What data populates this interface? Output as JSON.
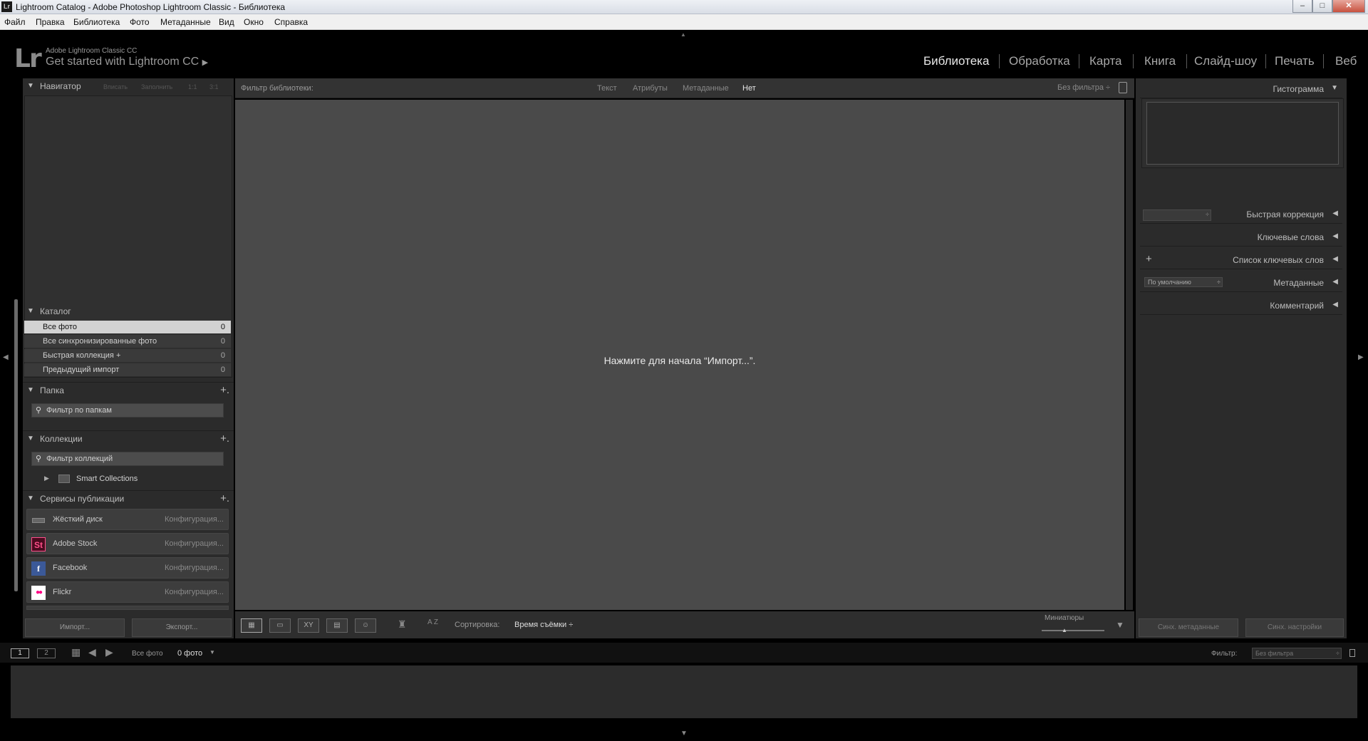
{
  "window": {
    "title": "Lightroom Catalog - Adobe Photoshop Lightroom Classic - Библиотека",
    "app_badge": "Lr",
    "controls": {
      "minimize": "–",
      "maximize": "□",
      "close": "✕"
    }
  },
  "menu": [
    "Файл",
    "Правка",
    "Библиотека",
    "Фото",
    "Метаданные",
    "Вид",
    "Окно",
    "Справка"
  ],
  "header": {
    "logo": "Lr",
    "product": "Adobe Lightroom Classic CC",
    "get_started": "Get started with Lightroom CC",
    "get_started_arrow": "▶",
    "modules": [
      "Библиотека",
      "Обработка",
      "Карта",
      "Книга",
      "Слайд-шоу",
      "Печать",
      "Веб"
    ],
    "active_module": "Библиотека"
  },
  "left": {
    "navigator": {
      "title": "Навигатор",
      "options": [
        "Вписать",
        "Заполнить",
        "1:1",
        "3:1"
      ]
    },
    "catalog": {
      "title": "Каталог",
      "items": [
        {
          "label": "Все фото",
          "count": "0"
        },
        {
          "label": "Все синхронизированные фото",
          "count": "0"
        },
        {
          "label": "Быстрая коллекция  +",
          "count": "0"
        },
        {
          "label": "Предыдущий импорт",
          "count": "0"
        }
      ]
    },
    "folders": {
      "title": "Папка",
      "plus": "+.",
      "filter_placeholder": "Фильтр по папкам"
    },
    "collections": {
      "title": "Коллекции",
      "plus": "+.",
      "filter_placeholder": "Фильтр коллекций",
      "smart": "Smart Collections"
    },
    "publish": {
      "title": "Сервисы публикации",
      "plus": "+.",
      "services": [
        {
          "name": "Жёсткий диск",
          "config": "Конфигурация..."
        },
        {
          "name": "Adobe Stock",
          "config": "Конфигурация..."
        },
        {
          "name": "Facebook",
          "config": "Конфигурация..."
        },
        {
          "name": "Flickr",
          "config": "Конфигурация..."
        }
      ],
      "icons": {
        "stock": "St",
        "facebook": "f",
        "flickr": "●●"
      }
    },
    "import_btn": "Импорт...",
    "export_btn": "Экспорт..."
  },
  "filter_bar": {
    "label": "Фильтр библиотеки:",
    "tabs": [
      "Текст",
      "Атрибуты",
      "Метаданные",
      "Нет"
    ],
    "active_tab": "Нет",
    "preset": "Без фильтра ÷"
  },
  "center": {
    "message": "Нажмите для начала “Импорт...”."
  },
  "toolbar": {
    "sort_label": "Сортировка:",
    "sort_value": "Время съёмки ÷",
    "thumbs_label": "Миниатюры",
    "az_icon": "A Z"
  },
  "right": {
    "histogram": "Гистограмма",
    "sections": [
      "Быстрая коррекция",
      "Ключевые слова",
      "Список ключевых слов",
      "Метаданные",
      "Комментарий"
    ],
    "metadata_preset": "По умолчанию",
    "keyword_plus": "+",
    "sync_metadata": "Синх. метаданные",
    "sync_settings": "Синх. настройки"
  },
  "filmstrip": {
    "screens": [
      "1",
      "2"
    ],
    "source": "Все фото",
    "count": "0 фото",
    "filter_label": "Фильтр:",
    "filter_value": "Без фильтра"
  }
}
